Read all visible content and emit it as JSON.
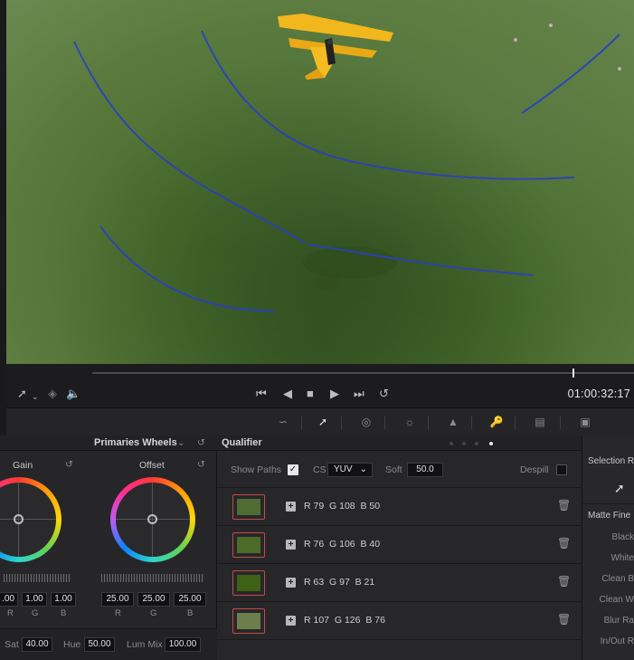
{
  "viewer": {
    "scene": "aerial-view-biplane-over-green-water-with-qualifier-strokes"
  },
  "transport": {
    "timecode": "01:00:32:17",
    "icons": [
      "qualifier-picker-icon",
      "dropdown-icon",
      "layers-icon",
      "speaker-icon",
      "skip-to-start-icon",
      "play-reverse-icon",
      "stop-icon",
      "play-icon",
      "skip-to-end-icon",
      "loop-icon"
    ]
  },
  "toolbar": {
    "icons": [
      "curves-icon",
      "qualifier-icon",
      "power-window-icon",
      "tracker-icon",
      "blur-icon",
      "key-icon",
      "sizing-icon",
      "3d-icon"
    ]
  },
  "wheels": {
    "title": "Primaries Wheels",
    "gain": {
      "label": "Gain",
      "values": [
        ".00",
        "1.00",
        "1.00"
      ],
      "channels": [
        "R",
        "G",
        "B"
      ]
    },
    "offset": {
      "label": "Offset",
      "values": [
        "25.00",
        "25.00",
        "25.00"
      ],
      "channels": [
        "R",
        "G",
        "B"
      ]
    },
    "footer": {
      "sat_label": "Sat",
      "sat_value": "40.00",
      "hue_label": "Hue",
      "hue_value": "50.00",
      "lummix_label": "Lum Mix",
      "lummix_value": "100.00"
    }
  },
  "qualifier": {
    "title": "Qualifier",
    "show_paths_label": "Show Paths",
    "show_paths_checked": true,
    "cs_label": "CS",
    "cs_value": "YUV",
    "soft_label": "Soft",
    "soft_value": "50.0",
    "despill_label": "Despill",
    "despill_checked": false,
    "samples": [
      {
        "color": "#4f6c32",
        "r": "R 79",
        "g": "G 108",
        "b": "B 50"
      },
      {
        "color": "#4c6a28",
        "r": "R 76",
        "g": "G 106",
        "b": "B 40"
      },
      {
        "color": "#3f6115",
        "r": "R 63",
        "g": "G 97",
        "b": "B 21"
      },
      {
        "color": "#6b7e4c",
        "r": "R 107",
        "g": "G 126",
        "b": "B 76"
      }
    ]
  },
  "selection": {
    "title": "Selection R",
    "matte_title": "Matte Fine",
    "items": [
      "Black",
      "White",
      "Clean B",
      "Clean W",
      "Blur Ra",
      "In/Out R"
    ]
  }
}
